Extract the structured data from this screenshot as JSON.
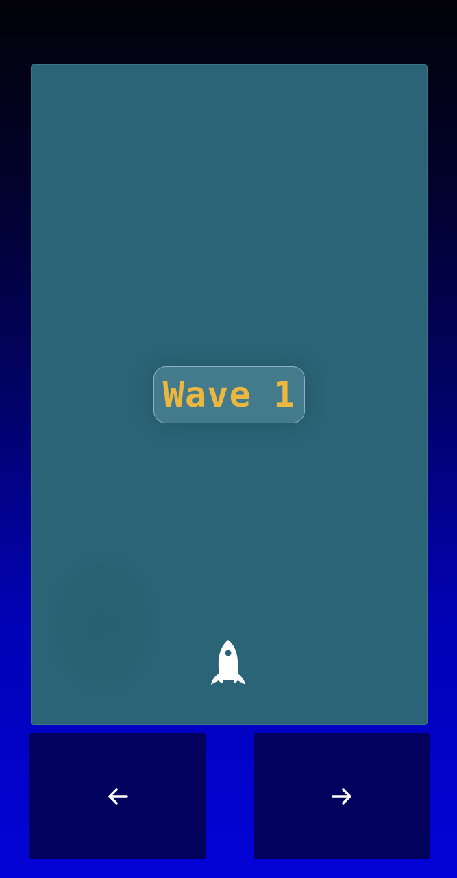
{
  "game": {
    "wave_label": "Wave 1",
    "wave_color": "#ebb73f",
    "board_color": "#2b6476",
    "player_icon": "rocket-icon"
  },
  "controls": {
    "left_icon": "arrow-left-icon",
    "right_icon": "arrow-right-icon",
    "button_color": "#02025e"
  }
}
